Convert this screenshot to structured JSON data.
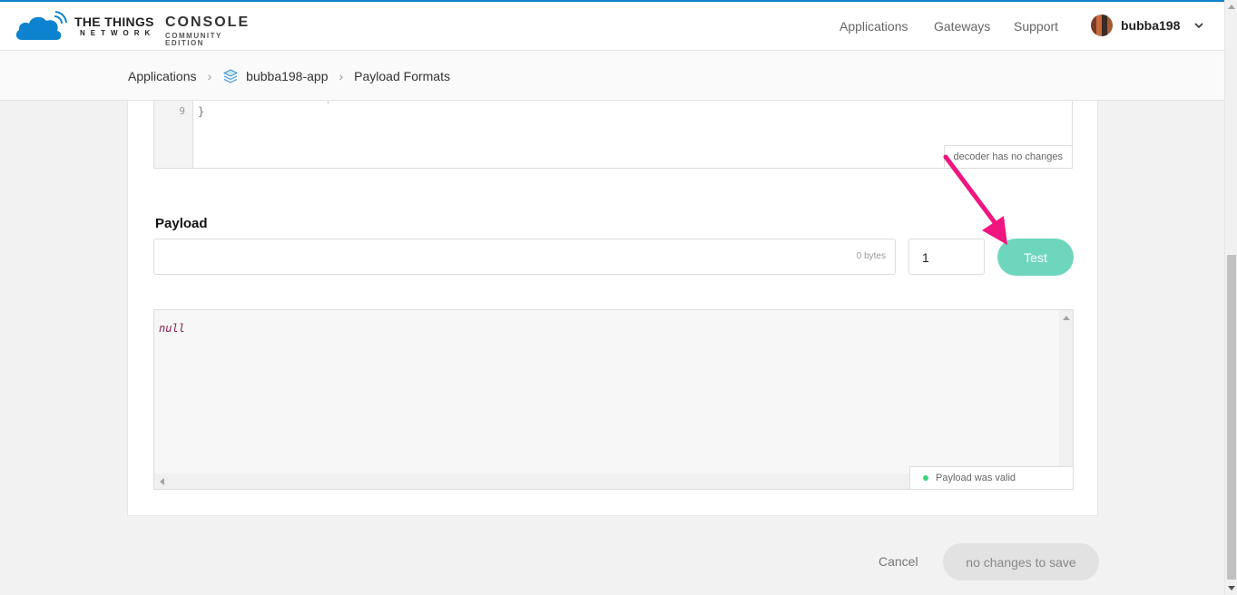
{
  "header": {
    "logo": {
      "line1": "THE THINGS",
      "line2": "NETWORK",
      "product": "CONSOLE",
      "edition": "COMMUNITY EDITION"
    },
    "nav": [
      {
        "label": "Applications"
      },
      {
        "label": "Gateways"
      },
      {
        "label": "Support"
      }
    ],
    "user": {
      "name": "bubba198"
    }
  },
  "breadcrumb": {
    "items": [
      {
        "label": "Applications"
      },
      {
        "label": "bubba198-app"
      },
      {
        "label": "Payload Formats"
      }
    ]
  },
  "editor": {
    "line_number": "9",
    "code_line": "}",
    "status": "decoder has no changes"
  },
  "payload": {
    "label": "Payload",
    "input_value": "",
    "bytes_label": "0 bytes",
    "port_value": "1",
    "test_label": "Test"
  },
  "result": {
    "output": "null",
    "status": "Payload was valid"
  },
  "footer": {
    "cancel_label": "Cancel",
    "save_label": "no changes to save"
  },
  "colors": {
    "accent_bar": "#0d83d0",
    "test_button": "#6fd6be",
    "annotation_arrow": "#f0157f",
    "valid_dot": "#3ed47b"
  }
}
